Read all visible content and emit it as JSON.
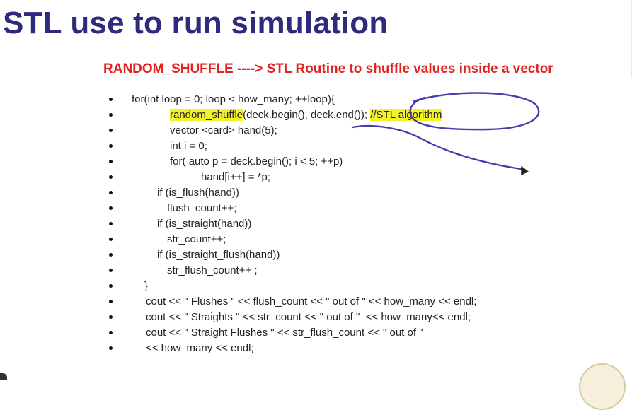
{
  "slide": {
    "title": "STL use to run simulation",
    "subtitle": "RANDOM_SHUFFLE   ----> STL Routine to shuffle values inside a vector"
  },
  "colors": {
    "title": "#2e2a7d",
    "subtitle": "#e32222",
    "highlight": "#f3f32a",
    "annotation_pen": "#4a3cae"
  },
  "code": {
    "lines": [
      {
        "parts": [
          "for(int loop = 0; loop < how_many; ++loop){"
        ]
      },
      {
        "parts": [
          "random_shuffle",
          "(deck.begin(), deck.end());",
          " ",
          "//STL algorithm"
        ]
      },
      {
        "parts": [
          "vector <card> hand(5);"
        ]
      },
      {
        "parts": [
          "int i = 0;"
        ]
      },
      {
        "parts": [
          "for( auto p = deck.begin(); i < 5; ++p)"
        ]
      },
      {
        "parts": [
          "hand[i++] = *p;"
        ]
      },
      {
        "parts": [
          "if (is_flush(hand))"
        ]
      },
      {
        "parts": [
          "flush_count++;"
        ]
      },
      {
        "parts": [
          "if (is_straight(hand))"
        ]
      },
      {
        "parts": [
          "str_count++;"
        ]
      },
      {
        "parts": [
          "if (is_straight_flush(hand))"
        ]
      },
      {
        "parts": [
          "str_flush_count++ ;"
        ]
      },
      {
        "parts": [
          "}"
        ]
      },
      {
        "parts": [
          "cout << \" Flushes \" << flush_count << \" out of \" << how_many << endl;"
        ]
      },
      {
        "parts": [
          "cout << \" Straights \" << str_count << \" out of \"  << how_many<< endl;"
        ]
      },
      {
        "parts": [
          "cout << \" Straight Flushes \" << str_flush_count << \" out of \""
        ]
      },
      {
        "parts": [
          "<< how_many << endl;"
        ]
      }
    ]
  }
}
